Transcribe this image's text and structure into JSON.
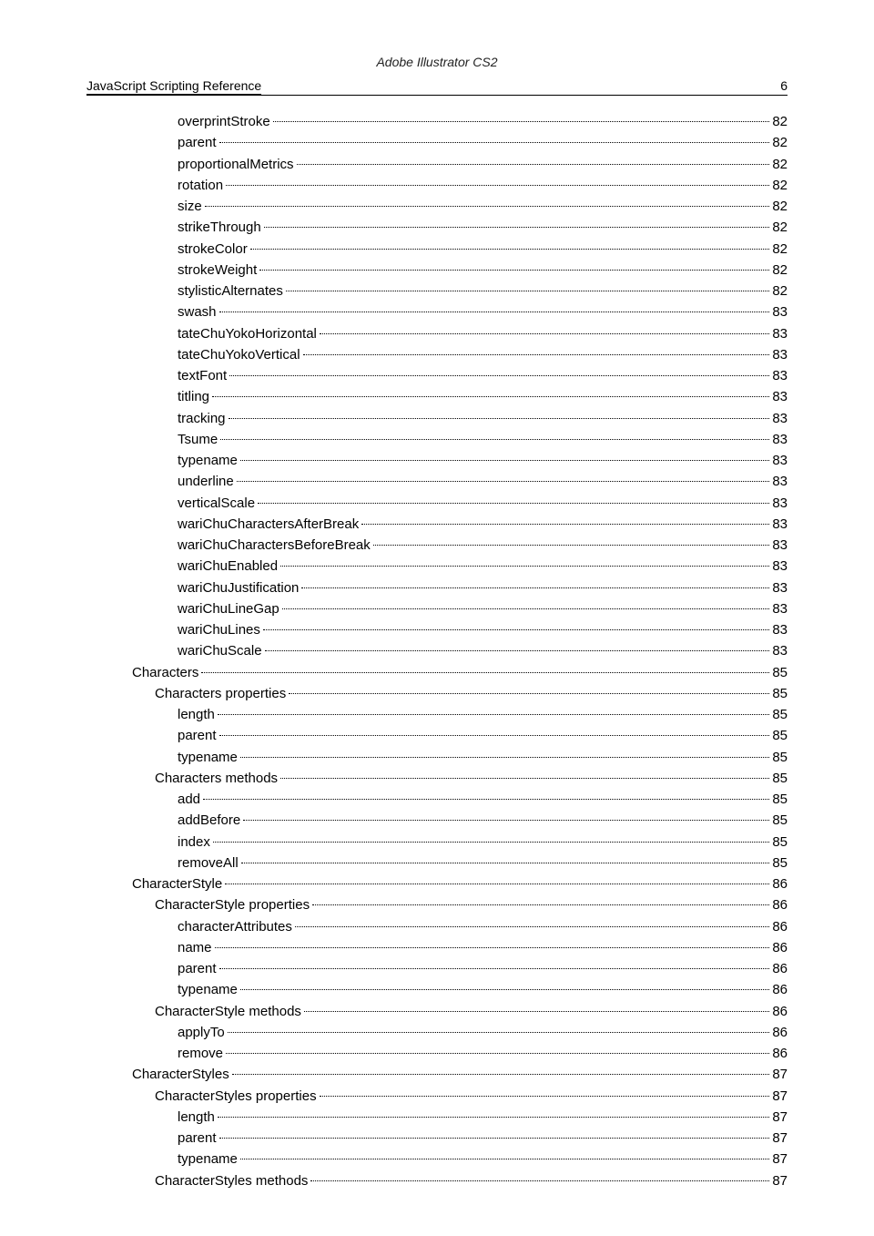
{
  "header": {
    "title": "Adobe Illustrator CS2",
    "left": "JavaScript Scripting Reference",
    "pageNumber": "6"
  },
  "toc": [
    {
      "label": "overprintStroke",
      "page": "82",
      "indent": 2
    },
    {
      "label": "parent",
      "page": "82",
      "indent": 2
    },
    {
      "label": "proportionalMetrics",
      "page": "82",
      "indent": 2
    },
    {
      "label": "rotation",
      "page": "82",
      "indent": 2
    },
    {
      "label": "size",
      "page": "82",
      "indent": 2
    },
    {
      "label": "strikeThrough",
      "page": "82",
      "indent": 2
    },
    {
      "label": "strokeColor",
      "page": "82",
      "indent": 2
    },
    {
      "label": "strokeWeight",
      "page": "82",
      "indent": 2
    },
    {
      "label": "stylisticAlternates",
      "page": "82",
      "indent": 2
    },
    {
      "label": "swash",
      "page": "83",
      "indent": 2
    },
    {
      "label": "tateChuYokoHorizontal",
      "page": "83",
      "indent": 2
    },
    {
      "label": "tateChuYokoVertical",
      "page": "83",
      "indent": 2
    },
    {
      "label": "textFont",
      "page": "83",
      "indent": 2
    },
    {
      "label": "titling",
      "page": "83",
      "indent": 2
    },
    {
      "label": "tracking",
      "page": "83",
      "indent": 2
    },
    {
      "label": "Tsume",
      "page": "83",
      "indent": 2
    },
    {
      "label": "typename",
      "page": "83",
      "indent": 2
    },
    {
      "label": "underline",
      "page": "83",
      "indent": 2
    },
    {
      "label": "verticalScale",
      "page": "83",
      "indent": 2
    },
    {
      "label": "wariChuCharactersAfterBreak",
      "page": "83",
      "indent": 2
    },
    {
      "label": "wariChuCharactersBeforeBreak",
      "page": "83",
      "indent": 2
    },
    {
      "label": "wariChuEnabled",
      "page": "83",
      "indent": 2
    },
    {
      "label": "wariChuJustification",
      "page": "83",
      "indent": 2
    },
    {
      "label": "wariChuLineGap",
      "page": "83",
      "indent": 2
    },
    {
      "label": "wariChuLines",
      "page": "83",
      "indent": 2
    },
    {
      "label": "wariChuScale",
      "page": "83",
      "indent": 2
    },
    {
      "label": "Characters",
      "page": "85",
      "indent": 0
    },
    {
      "label": "Characters properties",
      "page": "85",
      "indent": 1
    },
    {
      "label": "length",
      "page": "85",
      "indent": 2
    },
    {
      "label": "parent",
      "page": "85",
      "indent": 2
    },
    {
      "label": "typename",
      "page": "85",
      "indent": 2
    },
    {
      "label": "Characters methods",
      "page": "85",
      "indent": 1
    },
    {
      "label": "add",
      "page": "85",
      "indent": 2
    },
    {
      "label": "addBefore",
      "page": "85",
      "indent": 2
    },
    {
      "label": "index",
      "page": "85",
      "indent": 2
    },
    {
      "label": "removeAll",
      "page": "85",
      "indent": 2
    },
    {
      "label": "CharacterStyle",
      "page": "86",
      "indent": 0
    },
    {
      "label": "CharacterStyle properties",
      "page": "86",
      "indent": 1
    },
    {
      "label": "characterAttributes",
      "page": "86",
      "indent": 2
    },
    {
      "label": "name",
      "page": "86",
      "indent": 2
    },
    {
      "label": "parent",
      "page": "86",
      "indent": 2
    },
    {
      "label": "typename",
      "page": "86",
      "indent": 2
    },
    {
      "label": "CharacterStyle methods",
      "page": "86",
      "indent": 1
    },
    {
      "label": "applyTo",
      "page": "86",
      "indent": 2
    },
    {
      "label": "remove",
      "page": "86",
      "indent": 2
    },
    {
      "label": "CharacterStyles",
      "page": "87",
      "indent": 0
    },
    {
      "label": "CharacterStyles properties",
      "page": "87",
      "indent": 1
    },
    {
      "label": "length",
      "page": "87",
      "indent": 2
    },
    {
      "label": "parent",
      "page": "87",
      "indent": 2
    },
    {
      "label": "typename",
      "page": "87",
      "indent": 2
    },
    {
      "label": "CharacterStyles methods",
      "page": "87",
      "indent": 1
    }
  ]
}
